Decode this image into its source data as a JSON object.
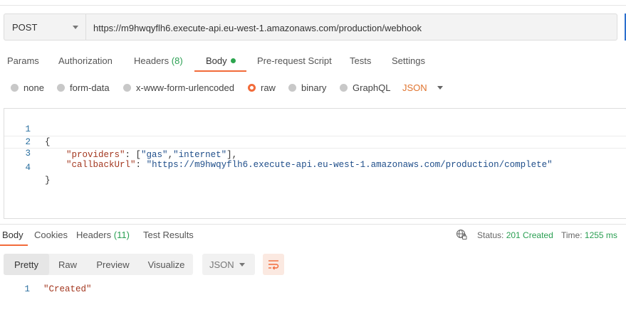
{
  "request": {
    "method": "POST",
    "url": "https://m9hwqyflh6.execute-api.eu-west-1.amazonaws.com/production/webhook"
  },
  "request_tabs": [
    {
      "label": "Params"
    },
    {
      "label": "Authorization"
    },
    {
      "label": "Headers",
      "count": "(8)"
    },
    {
      "label": "Body"
    },
    {
      "label": "Pre-request Script"
    },
    {
      "label": "Tests"
    },
    {
      "label": "Settings"
    }
  ],
  "body_types": [
    {
      "label": "none",
      "selected": false
    },
    {
      "label": "form-data",
      "selected": false
    },
    {
      "label": "x-www-form-urlencoded",
      "selected": false
    },
    {
      "label": "raw",
      "selected": true
    },
    {
      "label": "binary",
      "selected": false
    },
    {
      "label": "GraphQL",
      "selected": false
    }
  ],
  "raw_format": "JSON",
  "editor": {
    "lines": [
      {
        "n": "1",
        "open": "{"
      },
      {
        "n": "2",
        "key": "\"providers\"",
        "sep": ": [",
        "v1": "\"gas\"",
        "comma": ",",
        "v2": "\"internet\"",
        "close": "],"
      },
      {
        "n": "3",
        "key": "\"callbackUrl\"",
        "sep": ": ",
        "val": "\"https://m9hwqyflh6.execute-api.eu-west-1.amazonaws.com/production/complete\""
      },
      {
        "n": "4",
        "close": "}"
      }
    ]
  },
  "response_tabs": [
    {
      "label": "Body"
    },
    {
      "label": "Cookies"
    },
    {
      "label": "Headers",
      "count": "(11)"
    },
    {
      "label": "Test Results"
    }
  ],
  "response_status": {
    "status_label": "Status:",
    "status_value": "201 Created",
    "time_label": "Time:",
    "time_value": "1255 ms"
  },
  "view_modes": [
    "Pretty",
    "Raw",
    "Preview",
    "Visualize"
  ],
  "response_format": "JSON",
  "response_body": {
    "n": "1",
    "text": "\"Created\""
  },
  "colors": {
    "accent": "#f26b3a",
    "success": "#2a9f52",
    "json_key": "#a3371f",
    "json_string": "#1f4e8a"
  }
}
